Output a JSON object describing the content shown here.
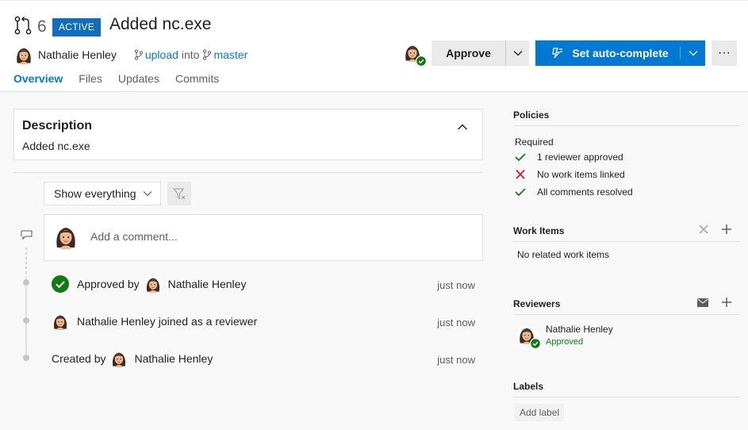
{
  "header": {
    "pr_id": "6",
    "status": "ACTIVE",
    "title": "Added nc.exe",
    "author": "Nathalie Henley",
    "source_branch": "upload",
    "into": "into",
    "target_branch": "master",
    "tabs": [
      {
        "label": "Overview",
        "active": true
      },
      {
        "label": "Files",
        "active": false
      },
      {
        "label": "Updates",
        "active": false
      },
      {
        "label": "Commits",
        "active": false
      }
    ],
    "approve_label": "Approve",
    "autocomplete_label": "Set auto-complete",
    "more_label": "···"
  },
  "description": {
    "title": "Description",
    "body": "Added nc.exe"
  },
  "activity": {
    "filter_label": "Show everything",
    "comment_placeholder": "Add a comment...",
    "items": [
      {
        "prefix": "Approved by",
        "user": "Nathalie Henley",
        "time": "just now"
      },
      {
        "text": "Nathalie Henley joined as a reviewer",
        "time": "just now"
      },
      {
        "prefix": "Created by",
        "user": "Nathalie Henley",
        "time": "just now"
      }
    ]
  },
  "sidebar": {
    "policies": {
      "title": "Policies",
      "required_label": "Required",
      "items": [
        {
          "label": "1 reviewer approved",
          "status": "pass"
        },
        {
          "label": "No work items linked",
          "status": "fail"
        },
        {
          "label": "All comments resolved",
          "status": "pass"
        }
      ]
    },
    "work_items": {
      "title": "Work Items",
      "empty": "No related work items"
    },
    "reviewers": {
      "title": "Reviewers",
      "items": [
        {
          "name": "Nathalie Henley",
          "vote": "Approved"
        }
      ]
    },
    "labels": {
      "title": "Labels",
      "add_label": "Add label"
    }
  },
  "colors": {
    "accent": "#0078d4",
    "success": "#107c10",
    "error": "#e81123",
    "badge": "#106ebe"
  }
}
